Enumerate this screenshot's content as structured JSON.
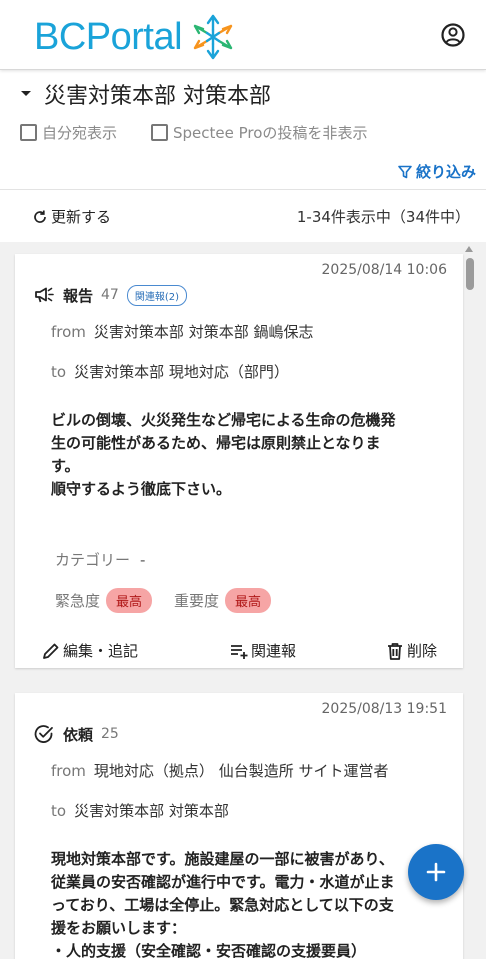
{
  "header": {
    "logo_text": "BCPortal",
    "account_icon": "account-circle-icon"
  },
  "page": {
    "title": "災害対策本部 対策本部"
  },
  "filters": {
    "only_mine_label": "自分宛表示",
    "hide_spectee_label": "Spectee Proの投稿を非表示",
    "narrow_label": "絞り込み"
  },
  "toolbar": {
    "refresh_label": "更新する",
    "count_text": "1-34件表示中（34件中）"
  },
  "posts": [
    {
      "date": "2025/08/14 10:06",
      "type": "報告",
      "type_icon": "megaphone-icon",
      "count": "47",
      "related_badge": "関連報(2)",
      "from_label": "from",
      "from": "災害対策本部 対策本部 鍋嶋保志",
      "to_label": "to",
      "to": "災害対策本部 現地対応（部門）",
      "body_lines": [
        "ビルの倒壊、火災発生など帰宅による生命の危機発",
        "生の可能性があるため、帰宅は原則禁止となりま",
        "す。",
        "順守するよう徹底下さい。"
      ],
      "category_label": "カテゴリー",
      "category_value": "-",
      "urgency_label": "緊急度",
      "urgency_value": "最高",
      "importance_label": "重要度",
      "importance_value": "最高",
      "action_edit": "編集・追記",
      "action_related": "関連報",
      "action_delete": "削除"
    },
    {
      "date": "2025/08/13 19:51",
      "type": "依頼",
      "type_icon": "check-circle-icon",
      "count": "25",
      "from_label": "from",
      "from": "現地対応（拠点） 仙台製造所 サイト運営者",
      "to_label": "to",
      "to": "災害対策本部 対策本部",
      "body_lines": [
        "現地対策本部です。施設建屋の一部に被害があり、",
        "従業員の安否確認が進行中です。電力・水道が止ま",
        "っており、工場は全停止。緊急対応として以下の支",
        "援をお願いします：",
        "・人的支援（安全確認・安否確認の支援要員）"
      ]
    }
  ],
  "fab": {
    "icon": "plus-icon"
  },
  "colors": {
    "brand": "#1aa3d9",
    "link": "#1a73c8",
    "priority_badge_bg": "#f6a5a5",
    "priority_badge_text": "#b01818"
  }
}
